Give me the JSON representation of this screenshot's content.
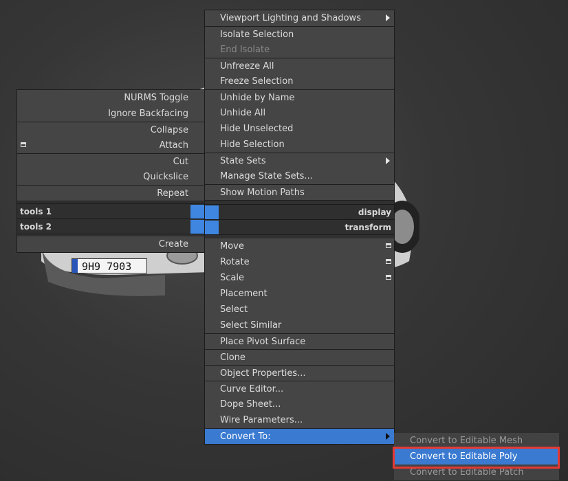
{
  "right_menu": {
    "items": [
      {
        "label": "Viewport Lighting and Shadows",
        "submenu": true
      },
      {
        "label": "Isolate Selection",
        "sep": true
      },
      {
        "label": "End Isolate",
        "disabled": true
      },
      {
        "label": "Unfreeze All",
        "sep": true
      },
      {
        "label": "Freeze Selection"
      },
      {
        "label": "Unhide by Name",
        "sep": true
      },
      {
        "label": "Unhide All"
      },
      {
        "label": "Hide Unselected"
      },
      {
        "label": "Hide Selection"
      },
      {
        "label": "State Sets",
        "submenu": true,
        "sep": true
      },
      {
        "label": "Manage State Sets..."
      },
      {
        "label": "Show Motion Paths",
        "sep": true
      }
    ],
    "quad_display": "display",
    "quad_transform": "transform",
    "lower_items": [
      {
        "label": "Move",
        "settings": true
      },
      {
        "label": "Rotate",
        "settings": true
      },
      {
        "label": "Scale",
        "settings": true
      },
      {
        "label": "Placement"
      },
      {
        "label": "Select"
      },
      {
        "label": "Select Similar"
      },
      {
        "label": "Place Pivot Surface",
        "sep": true
      },
      {
        "label": "Clone",
        "sep": true
      },
      {
        "label": "Object Properties...",
        "sep": true
      },
      {
        "label": "Curve Editor...",
        "sep": true
      },
      {
        "label": "Dope Sheet..."
      },
      {
        "label": "Wire Parameters..."
      },
      {
        "label": "Convert To:",
        "submenu": true,
        "sep": true,
        "highlight": true
      }
    ]
  },
  "left_menu": {
    "items": [
      {
        "label": "NURMS Toggle"
      },
      {
        "label": "Ignore Backfacing"
      },
      {
        "label": "Collapse",
        "sep": true
      },
      {
        "label": "Attach",
        "settings": true
      },
      {
        "label": "Cut",
        "sep": true
      },
      {
        "label": "Quickslice"
      },
      {
        "label": "Repeat",
        "sep": true
      }
    ],
    "quad_tools1": "tools 1",
    "quad_tools2": "tools 2",
    "create_label": "Create"
  },
  "convert_submenu": [
    {
      "label": "Convert to Editable Mesh"
    },
    {
      "label": "Convert to Editable Poly",
      "highlight": true
    },
    {
      "label": "Convert to Editable Patch"
    }
  ],
  "license_plate": "9H9 7903",
  "colors": {
    "highlight": "#3a7ad1",
    "callout": "#e53935",
    "quad_square": "#3f86e0"
  }
}
